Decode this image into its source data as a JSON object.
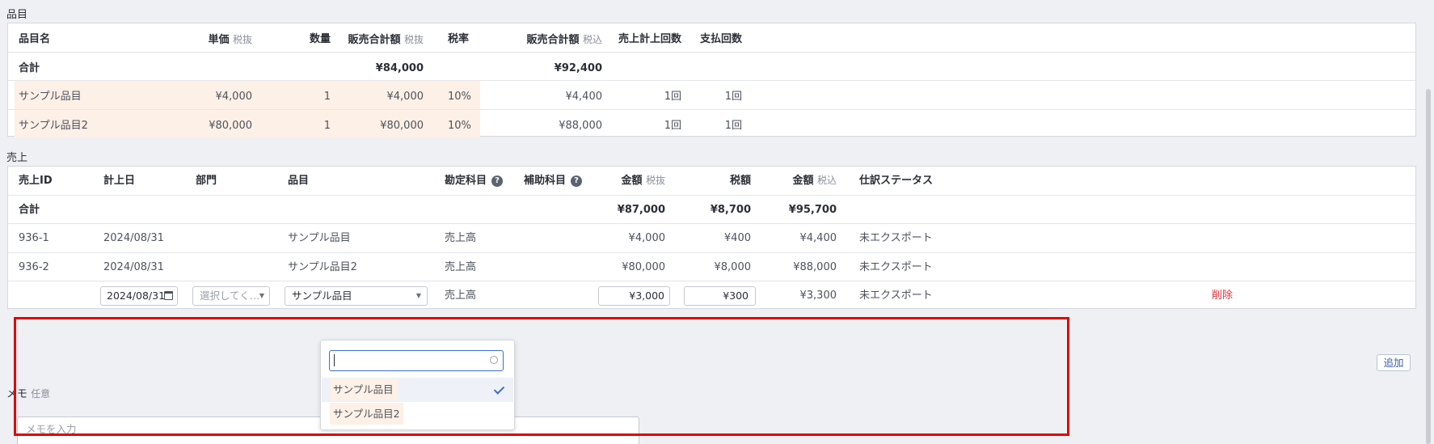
{
  "items_section": {
    "title": "品目",
    "headers": {
      "name": "品目名",
      "unit_price": "単価",
      "unit_price_sub": "税抜",
      "qty": "数量",
      "sales_total": "販売合計額",
      "sales_total_sub": "税抜",
      "tax_rate": "税率",
      "sales_total_incl": "販売合計額",
      "sales_total_incl_sub": "税込",
      "count_sales": "売上計上回数",
      "count_payments": "支払回数"
    },
    "total_row": {
      "label": "合計",
      "sales_total": "¥84,000",
      "sales_total_incl": "¥92,400"
    },
    "rows": [
      {
        "name": "サンプル品目",
        "unit_price": "¥4,000",
        "qty": "1",
        "sales_total": "¥4,000",
        "tax_rate": "10%",
        "sales_total_incl": "¥4,400",
        "count_sales": "1回",
        "count_payments": "1回"
      },
      {
        "name": "サンプル品目2",
        "unit_price": "¥80,000",
        "qty": "1",
        "sales_total": "¥80,000",
        "tax_rate": "10%",
        "sales_total_incl": "¥88,000",
        "count_sales": "1回",
        "count_payments": "1回"
      }
    ]
  },
  "sales_section": {
    "title": "売上",
    "headers": {
      "id": "売上ID",
      "date": "計上日",
      "dept": "部門",
      "item": "品目",
      "account": "勘定科目",
      "sub_account": "補助科目",
      "amount": "金額",
      "amount_sub": "税抜",
      "tax": "税額",
      "amount_incl": "金額",
      "amount_incl_sub": "税込",
      "status": "仕訳ステータス"
    },
    "total_row": {
      "label": "合計",
      "amount": "¥87,000",
      "tax": "¥8,700",
      "amount_incl": "¥95,700"
    },
    "rows": [
      {
        "id": "936-1",
        "date": "2024/08/31",
        "item": "サンプル品目",
        "account": "売上高",
        "amount": "¥4,000",
        "tax": "¥400",
        "amount_incl": "¥4,400",
        "status": "未エクスポート"
      },
      {
        "id": "936-2",
        "date": "2024/08/31",
        "item": "サンプル品目2",
        "account": "売上高",
        "amount": "¥80,000",
        "tax": "¥8,000",
        "amount_incl": "¥88,000",
        "status": "未エクスポート"
      }
    ],
    "edit_row": {
      "date": "2024/08/31",
      "dept_placeholder": "選択してく…",
      "item": "サンプル品目",
      "account": "売上高",
      "amount": "¥3,000",
      "tax": "¥300",
      "amount_incl": "¥3,300",
      "status": "未エクスポート",
      "delete_label": "削除"
    },
    "add_label": "追加"
  },
  "item_dropdown": {
    "search_value": "",
    "options": [
      {
        "label": "サンプル品目",
        "selected": true
      },
      {
        "label": "サンプル品目2",
        "selected": false
      }
    ]
  },
  "memo": {
    "title": "メモ",
    "optional": "任意",
    "placeholder": "メモを入力"
  },
  "colors": {
    "highlight": "#fdf0e6",
    "annotation_box": "#e00000",
    "delete_text": "#e0313a",
    "add_button_text": "#3a5bb0",
    "focus_border": "#3b6fd6"
  }
}
